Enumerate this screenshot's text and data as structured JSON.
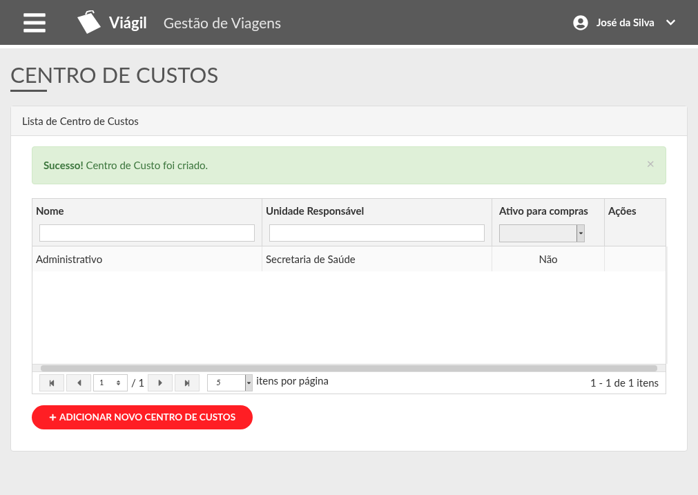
{
  "header": {
    "brand": "Viágil",
    "subtitle": "Gestão de Viagens",
    "user": "José da Silva"
  },
  "page": {
    "title": "CENTRO DE CUSTOS"
  },
  "panel": {
    "title": "Lista de Centro de Custos",
    "alert": {
      "message": "**Sucesso!** Centro de Custo foi criado.",
      "close": "×"
    },
    "table": {
      "columns": [
        {
          "label": "Nome",
          "kind": "text"
        },
        {
          "label": "Unidade Responsável",
          "kind": "text"
        },
        {
          "label": "Ativo para compras",
          "kind": "select"
        },
        {
          "label": "Ações",
          "kind": "none"
        }
      ],
      "rows": [
        {
          "cells": [
            "Administrativo",
            "Secretaria de Saúde",
            "Não"
          ]
        }
      ]
    },
    "pager": {
      "page": "1",
      "total_pages": "/ 1",
      "page_size": "5",
      "page_size_label": "itens por página",
      "summary": "1 - 1 de 1 itens"
    },
    "add_button": "ADICIONAR NOVO CENTRO DE CUSTOS"
  }
}
